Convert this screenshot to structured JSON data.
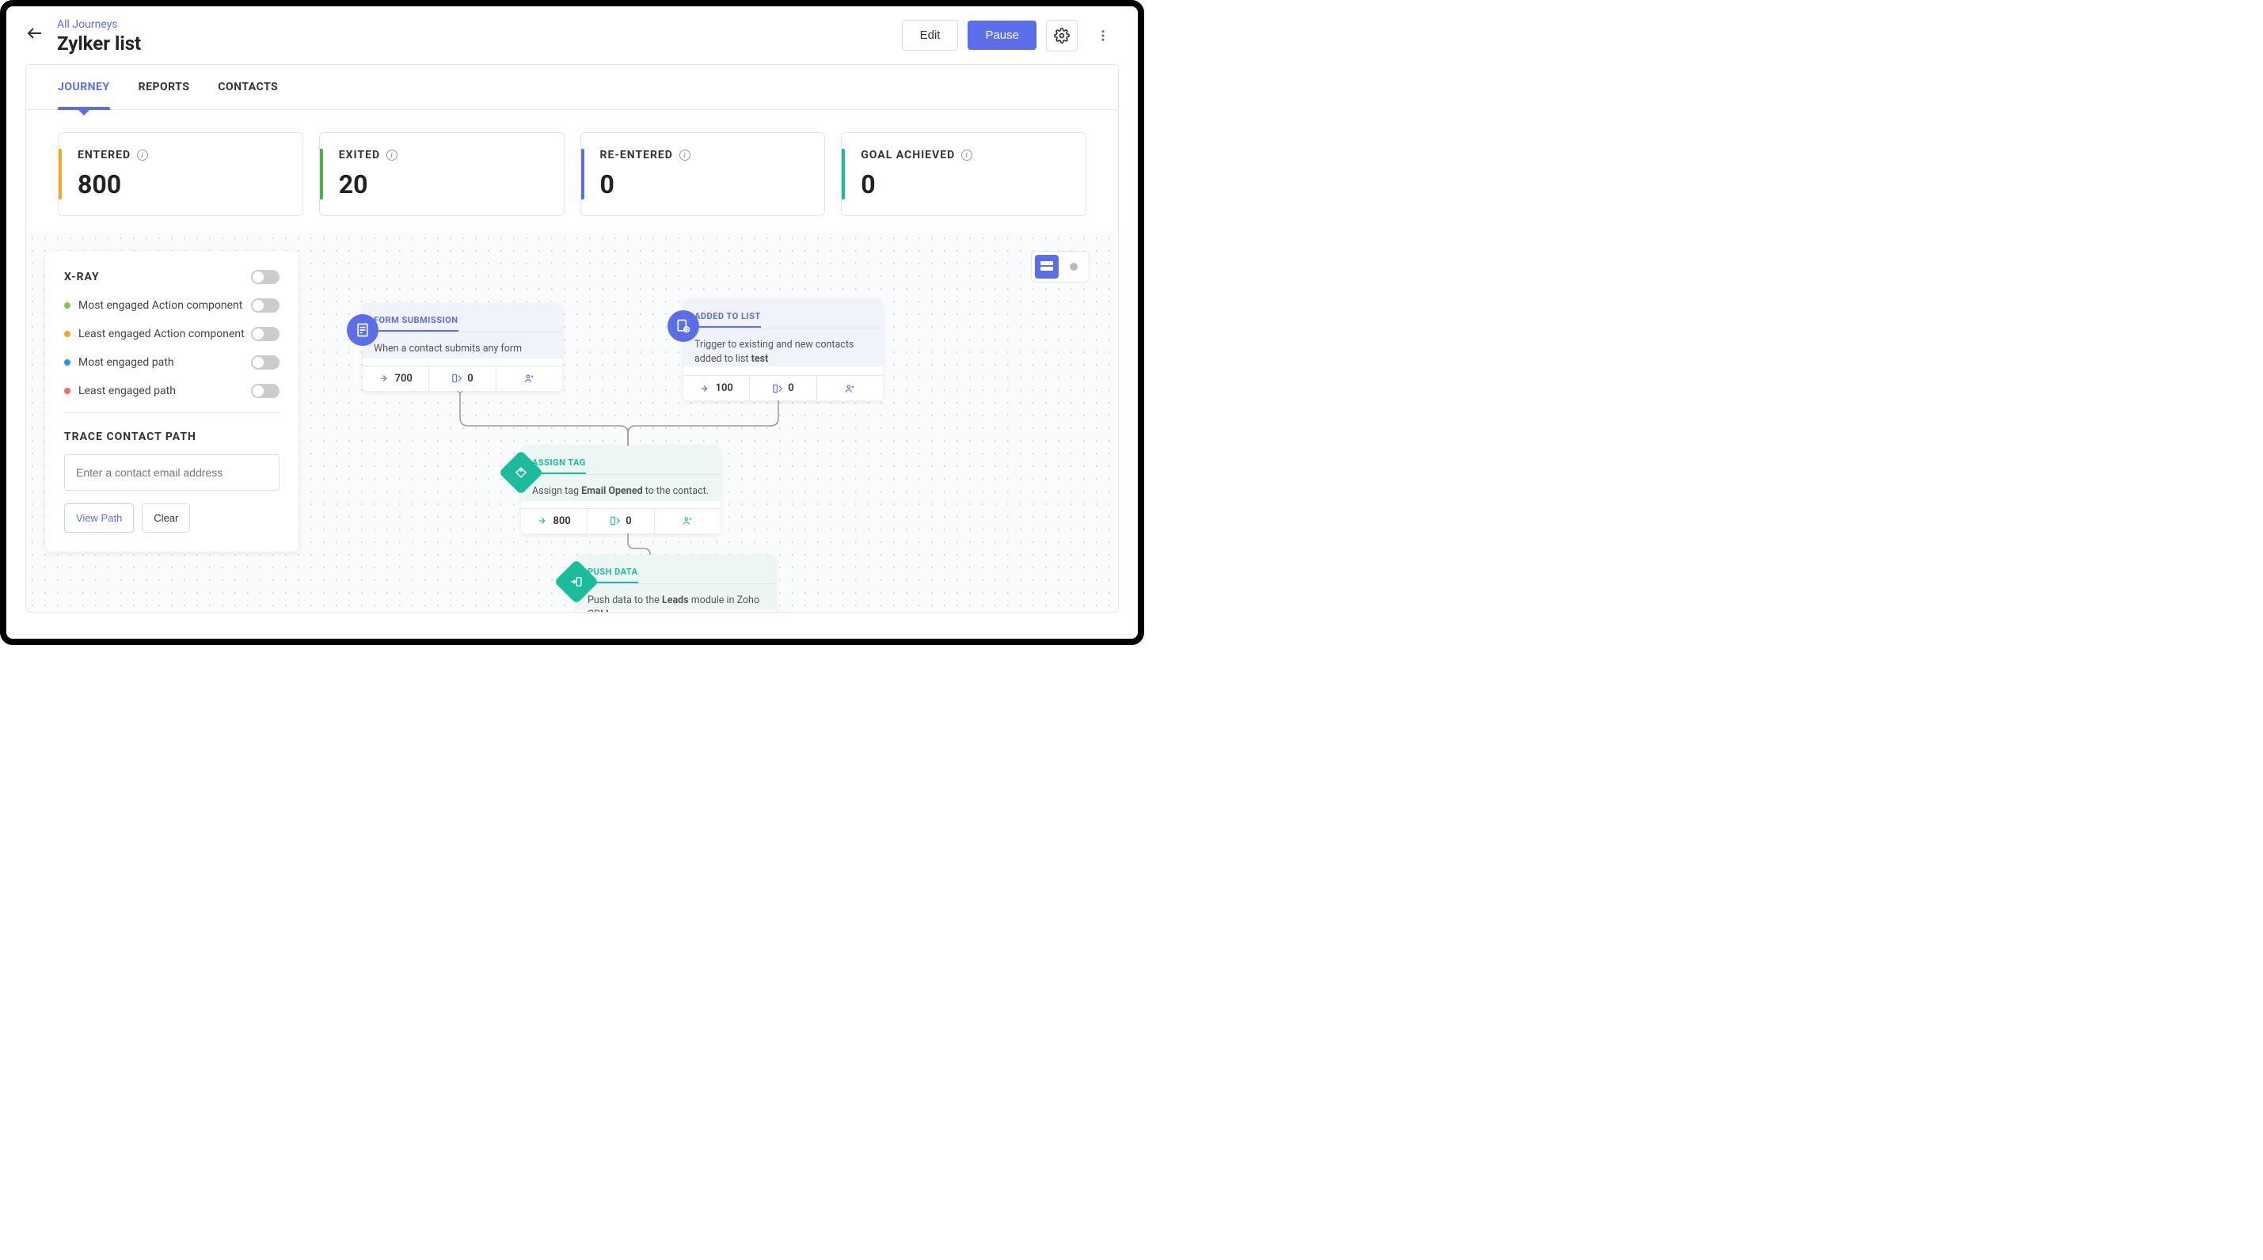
{
  "breadcrumb": "All Journeys",
  "pageTitle": "Zylker list",
  "headerActions": {
    "edit": "Edit",
    "pause": "Pause"
  },
  "tabs": {
    "journey": "JOURNEY",
    "reports": "REPORTS",
    "contacts": "CONTACTS"
  },
  "stats": {
    "entered": {
      "label": "ENTERED",
      "value": "800"
    },
    "exited": {
      "label": "EXITED",
      "value": "20"
    },
    "reentered": {
      "label": "RE-ENTERED",
      "value": "0"
    },
    "goal": {
      "label": "GOAL ACHIEVED",
      "value": "0"
    }
  },
  "xray": {
    "title": "X-RAY",
    "items": {
      "mostAction": "Most engaged Action component",
      "leastAction": "Least engaged Action component",
      "mostPath": "Most engaged path",
      "leastPath": "Least engaged path"
    },
    "traceTitle": "TRACE CONTACT PATH",
    "tracePlaceholder": "Enter a contact email address",
    "viewPath": "View Path",
    "clear": "Clear"
  },
  "nodes": {
    "formSubmission": {
      "title": "FORM SUBMISSION",
      "desc": "When a contact submits any form",
      "in": "700",
      "out": "0"
    },
    "addedToList": {
      "title": "ADDED TO LIST",
      "descPrefix": "Trigger to existing and new contacts added to list ",
      "descBold": "test",
      "in": "100",
      "out": "0"
    },
    "assignTag": {
      "title": "ASSIGN TAG",
      "descPrefix": "Assign tag ",
      "descBold": "Email Opened",
      "descSuffix": " to the contact.",
      "in": "800",
      "out": "0"
    },
    "pushData": {
      "title": "PUSH DATA",
      "descPrefix": "Push data to the ",
      "descBold": "Leads",
      "descSuffix": " module in Zoho CRM."
    }
  }
}
